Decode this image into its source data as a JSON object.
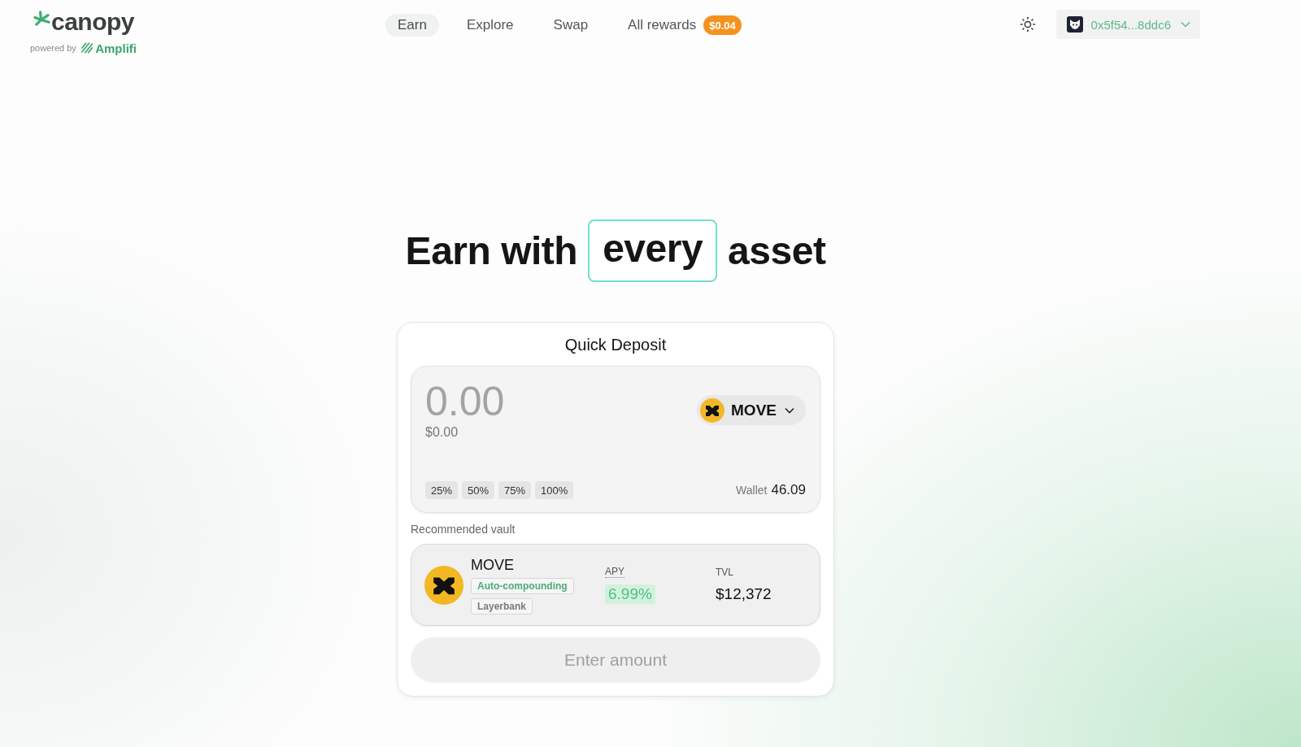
{
  "header": {
    "logo": {
      "name": "canopy",
      "powered_by": "powered by",
      "partner": "Amplifi"
    },
    "nav": [
      {
        "label": "Earn",
        "selected": true
      },
      {
        "label": "Explore",
        "selected": false
      },
      {
        "label": "Swap",
        "selected": false
      },
      {
        "label": "All rewards",
        "selected": false,
        "badge": "$0.04"
      }
    ],
    "wallet": {
      "address": "0x5f54...8ddc6"
    }
  },
  "hero": {
    "before": "Earn with",
    "highlight": "every",
    "after": "asset"
  },
  "quick_deposit": {
    "title": "Quick Deposit",
    "amount": {
      "placeholder": "0.00"
    },
    "fiat_value": "$0.00",
    "token": "MOVE",
    "presets": [
      "25%",
      "50%",
      "75%",
      "100%"
    ],
    "wallet_label": "Wallet",
    "wallet_balance": "46.09",
    "recommended_label": "Recommended vault",
    "vault": {
      "name": "MOVE",
      "tags": [
        {
          "label": "Auto-compounding",
          "kind": "feature"
        },
        {
          "label": "Layerbank",
          "kind": "protocol"
        }
      ],
      "apy_label": "APY",
      "apy": "6.99%",
      "tvl_label": "TVL",
      "tvl": "$12,372"
    },
    "submit": {
      "label": "Enter amount",
      "disabled": true
    }
  }
}
